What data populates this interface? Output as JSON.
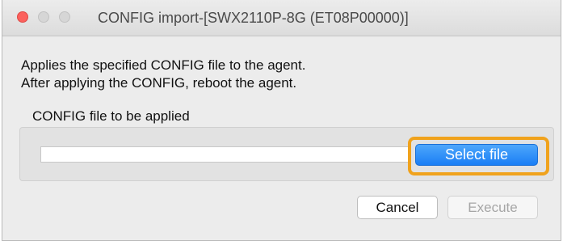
{
  "window": {
    "title": "CONFIG import-[SWX2110P-8G (ET08P00000)]"
  },
  "description": {
    "line1": "Applies the specified CONFIG file to the agent.",
    "line2": "After applying the CONFIG, reboot the agent."
  },
  "config_file": {
    "label": "CONFIG file to be applied",
    "value": "",
    "select_button_label": "Select file"
  },
  "footer": {
    "cancel_label": "Cancel",
    "execute_label": "Execute",
    "execute_disabled": true
  },
  "colors": {
    "accent": "#1a7ef5",
    "focus_ring": "#f0a21c",
    "close_button": "#fc615d"
  },
  "icons": [
    "close-window-icon",
    "minimize-window-icon",
    "maximize-window-icon"
  ]
}
